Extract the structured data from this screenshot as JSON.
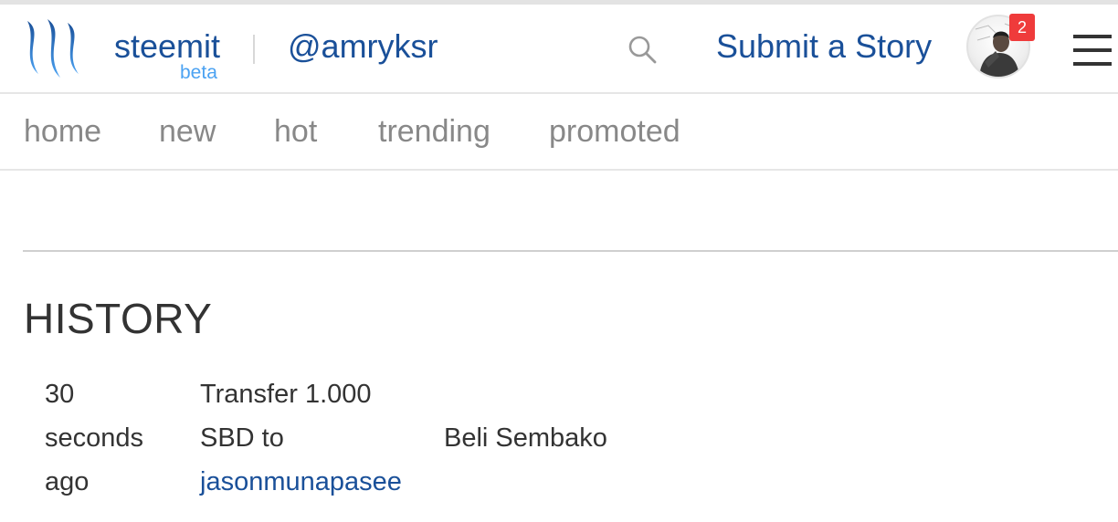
{
  "header": {
    "brand": "steemit",
    "beta": "beta",
    "username": "@amryksr",
    "submit_label": "Submit a Story",
    "notification_count": "2",
    "icons": {
      "logo": "steemit-logo",
      "search": "search-icon",
      "menu": "hamburger-menu-icon"
    },
    "colors": {
      "brand": "#1a5099",
      "beta": "#4ba2f2",
      "badge": "#ef3b3b"
    }
  },
  "nav": {
    "items": [
      "home",
      "new",
      "hot",
      "trending",
      "promoted"
    ]
  },
  "history": {
    "title": "HISTORY",
    "rows": [
      {
        "time_lines": [
          "30",
          "seconds",
          "ago"
        ],
        "action_lines": [
          "Transfer 1.000",
          "SBD to"
        ],
        "recipient": "jasonmunapasee",
        "memo": "Beli Sembako"
      }
    ]
  }
}
